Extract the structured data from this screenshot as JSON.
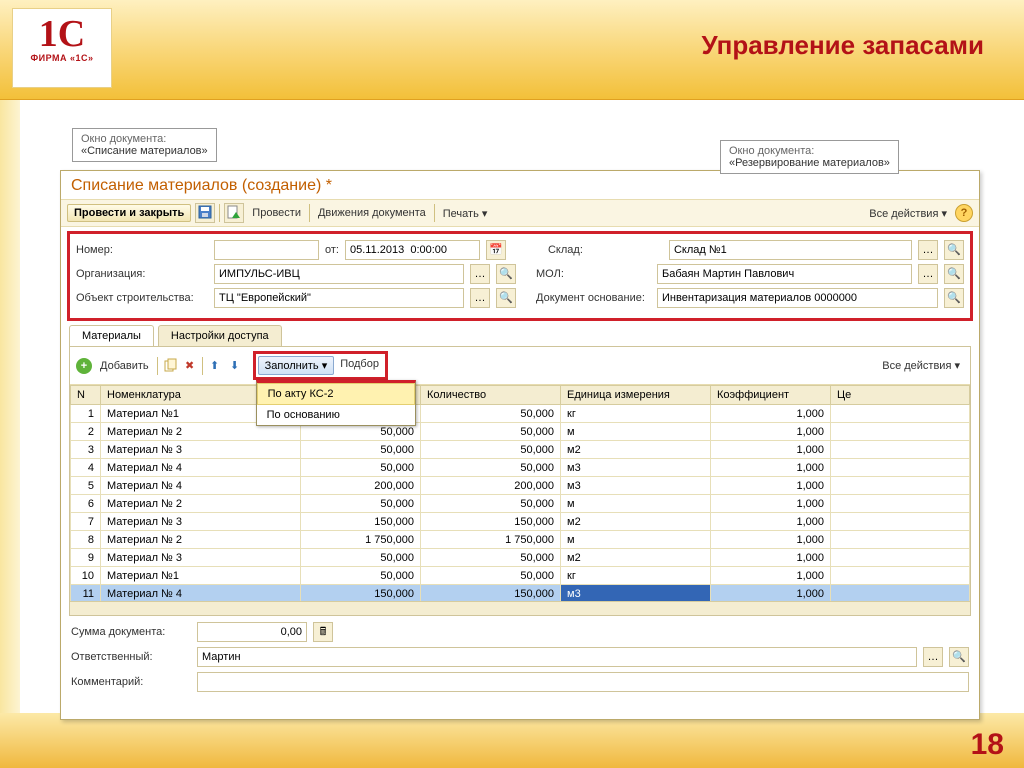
{
  "slide": {
    "title": "Управление запасами",
    "page": "18"
  },
  "logo": {
    "big": "1C",
    "small": "ФИРМА «1С»"
  },
  "callouts": {
    "left": {
      "l1": "Окно документа:",
      "l2": "«Списание материалов»"
    },
    "right": {
      "l1": "Окно документа:",
      "l2": "«Резервирование материалов»"
    }
  },
  "doc": {
    "title": "Списание материалов (создание) *"
  },
  "toolbar": {
    "primary": "Провести и закрыть",
    "post": "Провести",
    "movements": "Движения документа",
    "print": "Печать",
    "all_actions": "Все действия"
  },
  "form": {
    "number_lbl": "Номер:",
    "number_val": "",
    "date_lbl": "от:",
    "date_val": "05.11.2013  0:00:00",
    "warehouse_lbl": "Склад:",
    "warehouse_val": "Склад №1",
    "org_lbl": "Организация:",
    "org_val": "ИМПУЛЬС-ИВЦ",
    "mol_lbl": "МОЛ:",
    "mol_val": "Бабаян Мартин Павлович",
    "obj_lbl": "Объект строительства:",
    "obj_val": "ТЦ \"Европейский\"",
    "base_lbl": "Документ основание:",
    "base_val": "Инвентаризация материалов 0000000"
  },
  "tabs": {
    "materials": "Материалы",
    "access": "Настройки доступа"
  },
  "ttoolbar": {
    "add": "Добавить",
    "fill": "Заполнить",
    "select": "Подбор",
    "all": "Все действия"
  },
  "fill_menu": {
    "ks2": "По акту КС-2",
    "base": "По основанию"
  },
  "grid": {
    "headers": {
      "n": "N",
      "name": "Номенклатура",
      "qty1": "",
      "qty2": "Количество",
      "unit": "Единица измерения",
      "coef": "Коэффициент",
      "price": "Це"
    },
    "rows": [
      {
        "n": "1",
        "name": "Материал №1",
        "q1": "",
        "q2": "50,000",
        "unit": "кг",
        "coef": "1,000"
      },
      {
        "n": "2",
        "name": "Материал № 2",
        "q1": "50,000",
        "q2": "50,000",
        "unit": "м",
        "coef": "1,000"
      },
      {
        "n": "3",
        "name": "Материал № 3",
        "q1": "50,000",
        "q2": "50,000",
        "unit": "м2",
        "coef": "1,000"
      },
      {
        "n": "4",
        "name": "Материал № 4",
        "q1": "50,000",
        "q2": "50,000",
        "unit": "м3",
        "coef": "1,000"
      },
      {
        "n": "5",
        "name": "Материал № 4",
        "q1": "200,000",
        "q2": "200,000",
        "unit": "м3",
        "coef": "1,000"
      },
      {
        "n": "6",
        "name": "Материал № 2",
        "q1": "50,000",
        "q2": "50,000",
        "unit": "м",
        "coef": "1,000"
      },
      {
        "n": "7",
        "name": "Материал № 3",
        "q1": "150,000",
        "q2": "150,000",
        "unit": "м2",
        "coef": "1,000"
      },
      {
        "n": "8",
        "name": "Материал № 2",
        "q1": "1 750,000",
        "q2": "1 750,000",
        "unit": "м",
        "coef": "1,000"
      },
      {
        "n": "9",
        "name": "Материал № 3",
        "q1": "50,000",
        "q2": "50,000",
        "unit": "м2",
        "coef": "1,000"
      },
      {
        "n": "10",
        "name": "Материал №1",
        "q1": "50,000",
        "q2": "50,000",
        "unit": "кг",
        "coef": "1,000"
      },
      {
        "n": "11",
        "name": "Материал № 4",
        "q1": "150,000",
        "q2": "150,000",
        "unit": "м3",
        "coef": "1,000"
      }
    ]
  },
  "footer": {
    "sum_lbl": "Сумма документа:",
    "sum_val": "0,00",
    "resp_lbl": "Ответственный:",
    "resp_val": "Мартин",
    "comment_lbl": "Комментарий:",
    "comment_val": ""
  }
}
